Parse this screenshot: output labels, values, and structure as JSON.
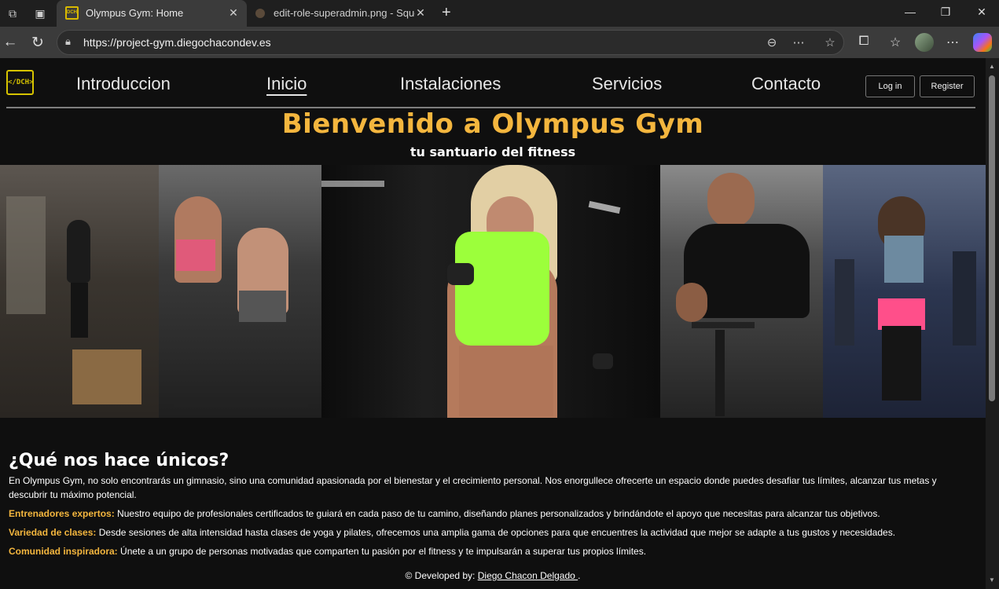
{
  "browser": {
    "tabs": [
      {
        "title": "Olympus Gym: Home",
        "active": true
      },
      {
        "title": "edit-role-superadmin.png - Squoosh",
        "active": false
      }
    ],
    "url": "https://project-gym.diegochacondev.es"
  },
  "site": {
    "logo_text": "</DCH>",
    "nav": [
      "Introduccion",
      "Inicio",
      "Instalaciones",
      "Servicios",
      "Contacto"
    ],
    "active_nav": "Inicio",
    "login_label": "Log in",
    "register_label": "Register"
  },
  "hero": {
    "title": "Bienvenido a Olympus Gym",
    "subtitle": "tu santuario del fitness"
  },
  "colors": {
    "accent": "#f4b63e",
    "background": "#0f0f0f",
    "chrome": "#1f1f1f"
  },
  "unique": {
    "title": "¿Qué nos hace únicos?",
    "intro": "En Olympus Gym, no solo encontrarás un gimnasio, sino una comunidad apasionada por el bienestar y el crecimiento personal. Nos enorgullece ofrecerte un espacio donde puedes desafiar tus límites, alcanzar tus metas y descubrir tu máximo potencial.",
    "features": [
      {
        "label": "Entrenadores expertos:",
        "text": " Nuestro equipo de profesionales certificados te guiará en cada paso de tu camino, diseñando planes personalizados y brindándote el apoyo que necesitas para alcanzar tus objetivos."
      },
      {
        "label": "Variedad de clases:",
        "text": " Desde sesiones de alta intensidad hasta clases de yoga y pilates, ofrecemos una amplia gama de opciones para que encuentres la actividad que mejor se adapte a tus gustos y necesidades."
      },
      {
        "label": "Comunidad inspiradora:",
        "text": " Únete a un grupo de personas motivadas que comparten tu pasión por el fitness y te impulsarán a superar tus propios límites."
      }
    ]
  },
  "footer": {
    "prefix": "© Developed by: ",
    "author": "Diego Chacon Delgado ",
    "suffix": "."
  }
}
